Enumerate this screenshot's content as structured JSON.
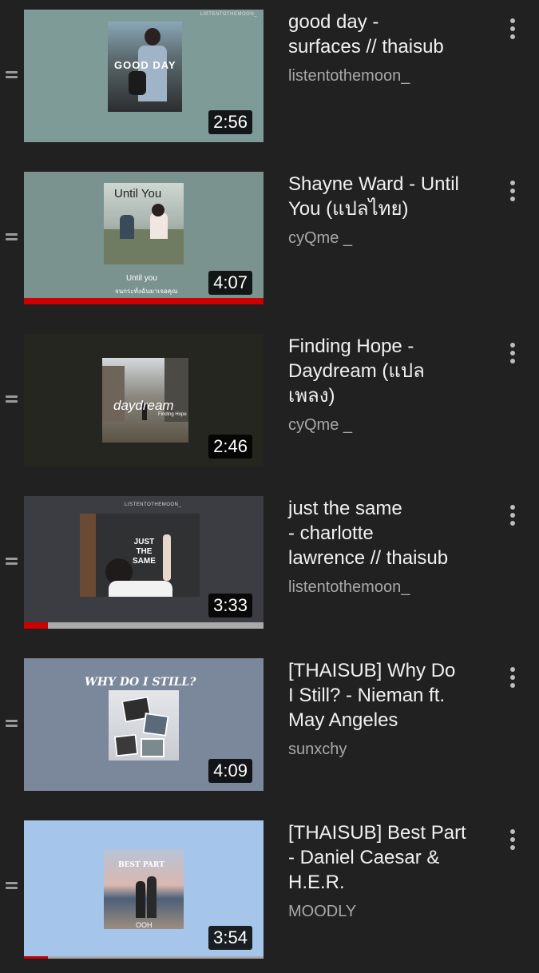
{
  "playlist": [
    {
      "title": "good day -\nsurfaces // thaisub",
      "channel": "listentothemoon_",
      "duration": "2:56",
      "thumb_bg": "#7f9b98",
      "overlay_text": "GOOD DAY",
      "brand_text": "LISTENTOTHEMOON_",
      "watch_progress": 0
    },
    {
      "title": "Shayne Ward - Until\nYou (แปลไทย)",
      "channel": "cyQme _",
      "duration": "4:07",
      "thumb_bg": "#7a938f",
      "overlay_text": "Until  You",
      "caption_line1": "Until  you",
      "caption_line2": "จนกระทั่งฉันมาเจอคุณ",
      "watch_progress": 1.0
    },
    {
      "title": "Finding Hope  -\nDaydream (แปล\nเพลง)",
      "channel": "cyQme _",
      "duration": "2:46",
      "thumb_bg": "#24261f",
      "overlay_text": "daydream",
      "sub_text": "Finding Hope",
      "watch_progress": 0
    },
    {
      "title": "just the same\n- charlotte\nlawrence // thaisub",
      "channel": "listentothemoon_",
      "duration": "3:33",
      "thumb_bg": "#3c3d42",
      "overlay_text": "JUST\nTHE\nSAME",
      "brand_text": "LISTENTOTHEMOON_",
      "watch_progress": 0.1
    },
    {
      "title": "[THAISUB] Why Do\nI Still? - Nieman ft.\nMay Angeles",
      "channel": "sunxchy",
      "duration": "4:09",
      "thumb_bg": "#7b879a",
      "overlay_text": "WHY DO I STILL?",
      "watch_progress": 0
    },
    {
      "title": "[THAISUB] Best Part\n- Daniel Caesar &\nH.E.R.",
      "channel": "MOODLY",
      "duration": "3:54",
      "thumb_bg": "#a5c5ea",
      "overlay_text": "BEST PART",
      "caption_line1": "OOH",
      "watch_progress": 0.1
    }
  ],
  "colors": {
    "background": "#212121",
    "progress_red": "#cc0000",
    "secondary_text": "#a8a8a8"
  },
  "icons": {
    "drag_handle": "drag-handle-icon",
    "more": "more-vert-icon"
  }
}
